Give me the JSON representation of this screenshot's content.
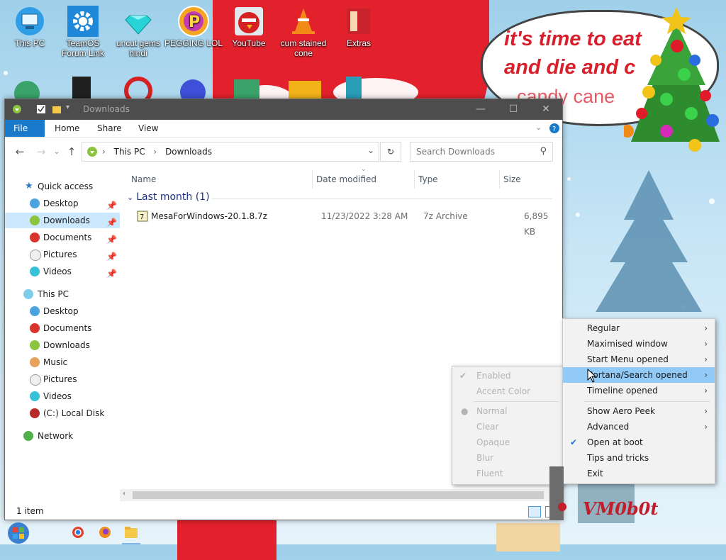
{
  "desktop": {
    "icons_row1": [
      {
        "label": "This PC",
        "icon": "this-pc-icon"
      },
      {
        "label": "TeamOS Forum Link",
        "icon": "gear-icon"
      },
      {
        "label": "uncut gems hindi",
        "icon": "diamond-icon"
      },
      {
        "label": "PEGGING LOL",
        "icon": "peggle-icon"
      },
      {
        "label": "YouTube",
        "icon": "angry-bird-icon"
      },
      {
        "label": "cum stained cone",
        "icon": "vlc-cone-icon"
      },
      {
        "label": "Extras",
        "icon": "extras-icon"
      }
    ],
    "speech_bubble": {
      "line1": "it's time to eat",
      "line2": "and die and c",
      "line3": "candy cane"
    },
    "watermark": "VM0b0t"
  },
  "explorer": {
    "title": "Downloads",
    "ribbon_tabs": [
      "File",
      "Home",
      "Share",
      "View"
    ],
    "address": {
      "crumb1": "This PC",
      "sep": "›",
      "crumb2": "Downloads"
    },
    "search_placeholder": "Search Downloads",
    "nav": {
      "quick_access": "Quick access",
      "quick_items": [
        "Desktop",
        "Downloads",
        "Documents",
        "Pictures",
        "Videos"
      ],
      "this_pc": "This PC",
      "pc_items": [
        "Desktop",
        "Documents",
        "Downloads",
        "Music",
        "Pictures",
        "Videos",
        "(C:) Local Disk"
      ],
      "network": "Network"
    },
    "columns": {
      "name": "Name",
      "date": "Date modified",
      "type": "Type",
      "size": "Size"
    },
    "group_label": "Last month (1)",
    "files": [
      {
        "name": "MesaForWindows-20.1.8.7z",
        "date": "11/23/2022 3:28 AM",
        "type": "7z Archive",
        "size": "6,895 KB"
      }
    ],
    "status": "1 item"
  },
  "context_menu": {
    "items": [
      {
        "label": "Regular",
        "submenu": true
      },
      {
        "label": "Maximised window",
        "submenu": true
      },
      {
        "label": "Start Menu opened",
        "submenu": true
      },
      {
        "label": "Cortana/Search opened",
        "submenu": true,
        "highlighted": true
      },
      {
        "label": "Timeline opened",
        "submenu": true
      },
      {
        "label": "Show Aero Peek",
        "submenu": true
      },
      {
        "label": "Advanced",
        "submenu": true
      },
      {
        "label": "Open at boot",
        "checked": true
      },
      {
        "label": "Tips and tricks"
      },
      {
        "label": "Exit"
      }
    ],
    "submenu_items": [
      {
        "label": "Enabled",
        "checked": true
      },
      {
        "label": "Accent Color"
      },
      {
        "label": "Normal",
        "radio": true
      },
      {
        "label": "Clear"
      },
      {
        "label": "Opaque"
      },
      {
        "label": "Blur"
      },
      {
        "label": "Fluent"
      }
    ]
  },
  "colors": {
    "accent": "#1979ca",
    "highlight": "#91c9f7",
    "selection": "#cce8ff",
    "group_text": "#1e3287"
  }
}
